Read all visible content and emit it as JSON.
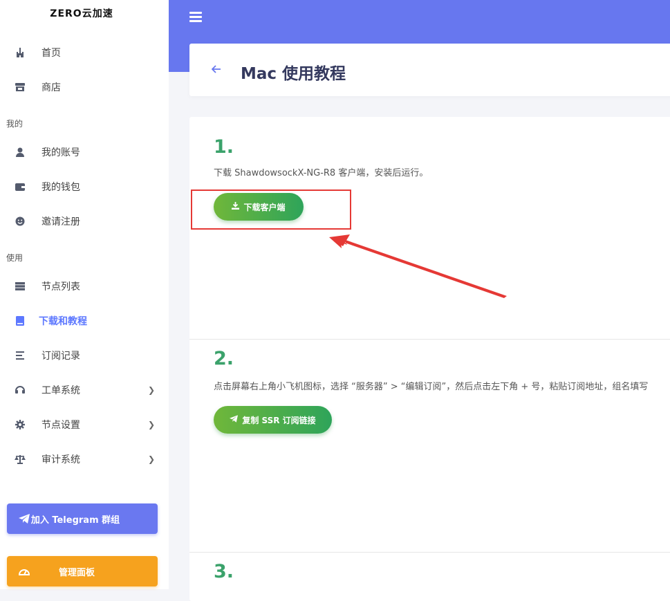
{
  "brand": "ZERO云加速",
  "sidebar": {
    "items": [
      {
        "label": "首页",
        "icon": "castle-icon"
      },
      {
        "label": "商店",
        "icon": "store-icon"
      },
      {
        "label": "我的账号",
        "icon": "user-icon"
      },
      {
        "label": "我的钱包",
        "icon": "wallet-icon"
      },
      {
        "label": "邀请注册",
        "icon": "smile-icon"
      },
      {
        "label": "节点列表",
        "icon": "server-icon"
      },
      {
        "label": "下载和教程",
        "icon": "book-icon"
      },
      {
        "label": "订阅记录",
        "icon": "list-icon"
      },
      {
        "label": "工单系统",
        "icon": "headset-icon"
      },
      {
        "label": "节点设置",
        "icon": "gear-icon"
      },
      {
        "label": "审计系统",
        "icon": "balance-scale-icon"
      }
    ],
    "sections": {
      "mine": "我的",
      "use": "使用"
    },
    "telegram_button": "加入 Telegram 群组",
    "admin_button": "管理面板"
  },
  "page": {
    "title": "Mac 使用教程"
  },
  "steps": [
    {
      "number": "1.",
      "text": "下载 ShawdowsockX-NG-R8 客户端，安装后运行。",
      "button": "下载客户端"
    },
    {
      "number": "2.",
      "text": "点击屏幕右上角小飞机图标，选择 “服务器” > “编辑订阅”，然后点击左下角 + 号，粘贴订阅地址，组名填写",
      "button": "复制 SSR 订阅链接"
    },
    {
      "number": "3."
    }
  ],
  "colors": {
    "topbar": "#6777ef",
    "accent": "#5d78ff",
    "green": "#3ba26b",
    "annotation": "#e53935",
    "admin": "#f6a21e"
  }
}
